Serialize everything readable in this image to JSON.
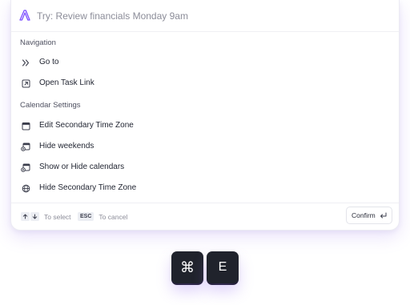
{
  "search": {
    "placeholder": "Try: Review financials Monday 9am"
  },
  "sections": [
    {
      "heading": "Navigation",
      "items": [
        {
          "label": "Go to",
          "icon": "double-chevron-right-icon"
        },
        {
          "label": "Open Task Link",
          "icon": "external-link-box-icon"
        }
      ]
    },
    {
      "heading": "Calendar Settings",
      "items": [
        {
          "label": "Edit Secondary Time Zone",
          "icon": "calendar-icon"
        },
        {
          "label": "Hide weekends",
          "icon": "calendar-toggle-icon"
        },
        {
          "label": "Show or Hide calendars",
          "icon": "calendar-toggle-icon"
        },
        {
          "label": "Hide Secondary Time Zone",
          "icon": "globe-icon"
        }
      ]
    }
  ],
  "footer": {
    "select_text": "To select",
    "esc_key": "ESC",
    "cancel_text": "To cancel",
    "confirm_label": "Confirm"
  },
  "shortcut": {
    "modifier": "⌘",
    "key": "E"
  },
  "colors": {
    "brand": "#7b4dff",
    "key_bg": "#20232c"
  }
}
